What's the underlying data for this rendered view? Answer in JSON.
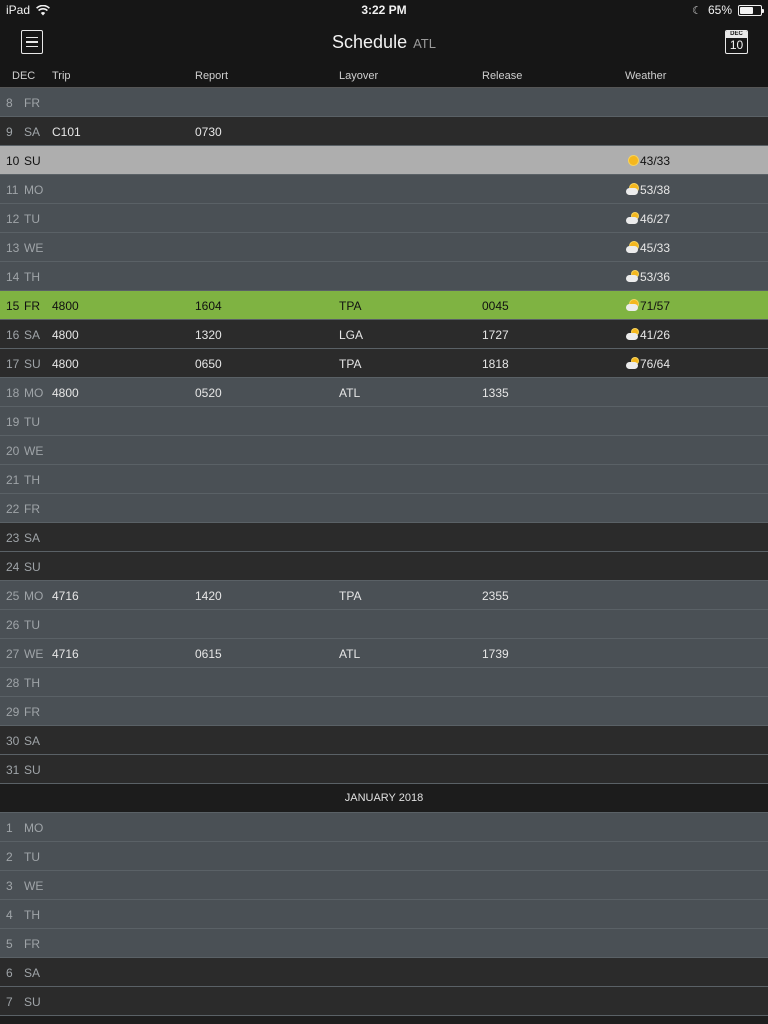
{
  "status_bar": {
    "device": "iPad",
    "time": "3:22 PM",
    "battery": "65%",
    "battery_level": 0.65
  },
  "nav": {
    "title": "Schedule",
    "subtitle": "ATL",
    "calendar_month": "DEC",
    "calendar_day": "10"
  },
  "columns": {
    "month": "DEC",
    "trip": "Trip",
    "report": "Report",
    "layover": "Layover",
    "release": "Release",
    "weather": "Weather"
  },
  "december_rows": [
    {
      "day": "8",
      "dow": "FR",
      "trip": "",
      "report": "",
      "layover": "",
      "release": "",
      "weather": "",
      "wx_icon": "",
      "style": "light"
    },
    {
      "day": "9",
      "dow": "SA",
      "trip": "C101",
      "report": "0730",
      "layover": "",
      "release": "",
      "weather": "",
      "wx_icon": "",
      "style": "dark"
    },
    {
      "day": "10",
      "dow": "SU",
      "trip": "",
      "report": "",
      "layover": "",
      "release": "",
      "weather": "43/33",
      "wx_icon": "sunny-icon",
      "style": "today"
    },
    {
      "day": "11",
      "dow": "MO",
      "trip": "",
      "report": "",
      "layover": "",
      "release": "",
      "weather": "53/38",
      "wx_icon": "partly-sunny-icon",
      "style": "light"
    },
    {
      "day": "12",
      "dow": "TU",
      "trip": "",
      "report": "",
      "layover": "",
      "release": "",
      "weather": "46/27",
      "wx_icon": "cloudy-icon",
      "style": "light"
    },
    {
      "day": "13",
      "dow": "WE",
      "trip": "",
      "report": "",
      "layover": "",
      "release": "",
      "weather": "45/33",
      "wx_icon": "partly-sunny-icon",
      "style": "light"
    },
    {
      "day": "14",
      "dow": "TH",
      "trip": "",
      "report": "",
      "layover": "",
      "release": "",
      "weather": "53/36",
      "wx_icon": "cloudy-icon",
      "style": "light"
    },
    {
      "day": "15",
      "dow": "FR",
      "trip": "4800",
      "report": "1604",
      "layover": "TPA",
      "release": "0045",
      "weather": "71/57",
      "wx_icon": "partly-sunny-icon",
      "style": "highlight"
    },
    {
      "day": "16",
      "dow": "SA",
      "trip": "4800",
      "report": "1320",
      "layover": "LGA",
      "release": "1727",
      "weather": "41/26",
      "wx_icon": "cloudy-icon",
      "style": "dark"
    },
    {
      "day": "17",
      "dow": "SU",
      "trip": "4800",
      "report": "0650",
      "layover": "TPA",
      "release": "1818",
      "weather": "76/64",
      "wx_icon": "cloudy-icon",
      "style": "dark"
    },
    {
      "day": "18",
      "dow": "MO",
      "trip": "4800",
      "report": "0520",
      "layover": "ATL",
      "release": "1335",
      "weather": "",
      "wx_icon": "",
      "style": "light"
    },
    {
      "day": "19",
      "dow": "TU",
      "trip": "",
      "report": "",
      "layover": "",
      "release": "",
      "weather": "",
      "wx_icon": "",
      "style": "light"
    },
    {
      "day": "20",
      "dow": "WE",
      "trip": "",
      "report": "",
      "layover": "",
      "release": "",
      "weather": "",
      "wx_icon": "",
      "style": "light"
    },
    {
      "day": "21",
      "dow": "TH",
      "trip": "",
      "report": "",
      "layover": "",
      "release": "",
      "weather": "",
      "wx_icon": "",
      "style": "light"
    },
    {
      "day": "22",
      "dow": "FR",
      "trip": "",
      "report": "",
      "layover": "",
      "release": "",
      "weather": "",
      "wx_icon": "",
      "style": "light"
    },
    {
      "day": "23",
      "dow": "SA",
      "trip": "",
      "report": "",
      "layover": "",
      "release": "",
      "weather": "",
      "wx_icon": "",
      "style": "dark"
    },
    {
      "day": "24",
      "dow": "SU",
      "trip": "",
      "report": "",
      "layover": "",
      "release": "",
      "weather": "",
      "wx_icon": "",
      "style": "dark"
    },
    {
      "day": "25",
      "dow": "MO",
      "trip": "4716",
      "report": "1420",
      "layover": "TPA",
      "release": "2355",
      "weather": "",
      "wx_icon": "",
      "style": "light"
    },
    {
      "day": "26",
      "dow": "TU",
      "trip": "",
      "report": "",
      "layover": "",
      "release": "",
      "weather": "",
      "wx_icon": "",
      "style": "light"
    },
    {
      "day": "27",
      "dow": "WE",
      "trip": "4716",
      "report": "0615",
      "layover": "ATL",
      "release": "1739",
      "weather": "",
      "wx_icon": "",
      "style": "light"
    },
    {
      "day": "28",
      "dow": "TH",
      "trip": "",
      "report": "",
      "layover": "",
      "release": "",
      "weather": "",
      "wx_icon": "",
      "style": "light"
    },
    {
      "day": "29",
      "dow": "FR",
      "trip": "",
      "report": "",
      "layover": "",
      "release": "",
      "weather": "",
      "wx_icon": "",
      "style": "light"
    },
    {
      "day": "30",
      "dow": "SA",
      "trip": "",
      "report": "",
      "layover": "",
      "release": "",
      "weather": "",
      "wx_icon": "",
      "style": "dark"
    },
    {
      "day": "31",
      "dow": "SU",
      "trip": "",
      "report": "",
      "layover": "",
      "release": "",
      "weather": "",
      "wx_icon": "",
      "style": "dark"
    }
  ],
  "month_separator": "JANUARY 2018",
  "january_rows": [
    {
      "day": "1",
      "dow": "MO",
      "style": "light"
    },
    {
      "day": "2",
      "dow": "TU",
      "style": "light"
    },
    {
      "day": "3",
      "dow": "WE",
      "style": "light"
    },
    {
      "day": "4",
      "dow": "TH",
      "style": "light"
    },
    {
      "day": "5",
      "dow": "FR",
      "style": "light"
    },
    {
      "day": "6",
      "dow": "SA",
      "style": "dark"
    },
    {
      "day": "7",
      "dow": "SU",
      "style": "dark"
    }
  ]
}
